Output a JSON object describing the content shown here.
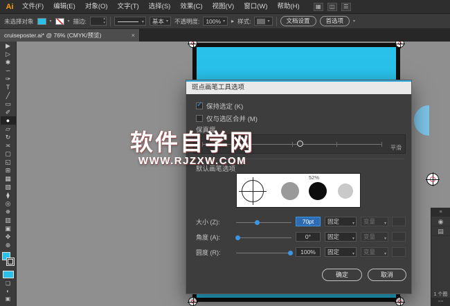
{
  "colors": {
    "accent": "#3b97e3",
    "artboard_cyan": "#29c1ea",
    "menubar_bg": "#2e2e2e",
    "dialog_bg": "#3d3d3d"
  },
  "menubar": {
    "logo": "Ai",
    "items": [
      "文件(F)",
      "编辑(E)",
      "对象(O)",
      "文字(T)",
      "选择(S)",
      "效果(C)",
      "视图(V)",
      "窗口(W)",
      "帮助(H)"
    ]
  },
  "controlbar": {
    "status": "未选择对象",
    "stroke_label": "描边:",
    "brush_definition": "基本",
    "opacity_label": "不透明度:",
    "opacity_value": "100%",
    "style_label": "样式:",
    "doc_setup_button": "文档设置",
    "preferences_button": "首选项"
  },
  "tabbar": {
    "title": "cruiseposter.ai* @ 76% (CMYK/预览)",
    "close": "×"
  },
  "tools": [
    {
      "name": "selection",
      "glyph": "▶"
    },
    {
      "name": "direct-selection",
      "glyph": "▷"
    },
    {
      "name": "magic-wand",
      "glyph": "✱"
    },
    {
      "name": "lasso",
      "glyph": "∽"
    },
    {
      "name": "pen",
      "glyph": "✑"
    },
    {
      "name": "type",
      "glyph": "T"
    },
    {
      "name": "line-segment",
      "glyph": "╱"
    },
    {
      "name": "rectangle",
      "glyph": "▭"
    },
    {
      "name": "paintbrush",
      "glyph": "✐"
    },
    {
      "name": "blob-brush",
      "glyph": "●"
    },
    {
      "name": "eraser",
      "glyph": "▱"
    },
    {
      "name": "rotate",
      "glyph": "↻"
    },
    {
      "name": "width",
      "glyph": "≍"
    },
    {
      "name": "free-transform",
      "glyph": "▢"
    },
    {
      "name": "shape-builder",
      "glyph": "◱"
    },
    {
      "name": "perspective-grid",
      "glyph": "⊞"
    },
    {
      "name": "mesh",
      "glyph": "▦"
    },
    {
      "name": "gradient",
      "glyph": "▧"
    },
    {
      "name": "eyedropper",
      "glyph": "⧫"
    },
    {
      "name": "blend",
      "glyph": "◎"
    },
    {
      "name": "symbol-sprayer",
      "glyph": "✵"
    },
    {
      "name": "column-graph",
      "glyph": "▥"
    },
    {
      "name": "artboard",
      "glyph": "▣"
    },
    {
      "name": "hand",
      "glyph": "✥"
    },
    {
      "name": "zoom",
      "glyph": "⊕"
    }
  ],
  "dialog": {
    "title": "斑点画笔工具选项",
    "keep_selected": "保持选定 (K)",
    "merge_only": "仅与选区合并 (M)",
    "fidelity_label": "保真度",
    "smooth_label": "平滑",
    "brush_options_label": "默认画笔选项",
    "preview_percent": "52%",
    "size": {
      "label": "大小 (Z):",
      "value": "70pt",
      "mode": "固定",
      "variation": "变量"
    },
    "angle": {
      "label": "角度 (A):",
      "value": "0°",
      "mode": "固定",
      "variation": "变量"
    },
    "roundness": {
      "label": "圆度 (R):",
      "value": "100%",
      "mode": "固定",
      "variation": "变量"
    },
    "ok": "确定",
    "cancel": "取消"
  },
  "watermark": {
    "line1": "软件自学网",
    "line2": "WWW.RJZXW.COM"
  },
  "right_panel": {
    "layers_count": "1 个图"
  }
}
